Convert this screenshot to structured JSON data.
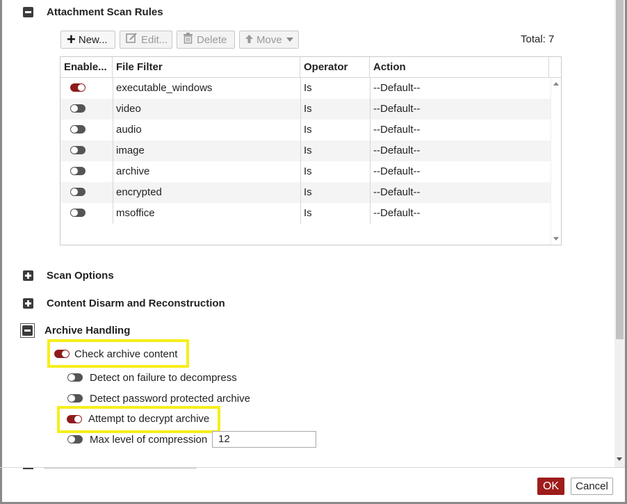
{
  "sections": {
    "attachment_scan_rules": "Attachment Scan Rules",
    "scan_options": "Scan Options",
    "cdr": "Content Disarm and Reconstruction",
    "archive_handling": "Archive Handling"
  },
  "toolbar": {
    "new_label": "New...",
    "edit_label": "Edit...",
    "delete_label": "Delete",
    "move_label": "Move",
    "total_label": "Total: 7"
  },
  "table": {
    "headers": [
      "Enable...",
      "File Filter",
      "Operator",
      "Action"
    ],
    "rows": [
      {
        "enabled": true,
        "filter": "executable_windows",
        "operator": "Is",
        "action": "--Default--"
      },
      {
        "enabled": false,
        "filter": "video",
        "operator": "Is",
        "action": "--Default--"
      },
      {
        "enabled": false,
        "filter": "audio",
        "operator": "Is",
        "action": "--Default--"
      },
      {
        "enabled": false,
        "filter": "image",
        "operator": "Is",
        "action": "--Default--"
      },
      {
        "enabled": false,
        "filter": "archive",
        "operator": "Is",
        "action": "--Default--"
      },
      {
        "enabled": false,
        "filter": "encrypted",
        "operator": "Is",
        "action": "--Default--"
      },
      {
        "enabled": false,
        "filter": "msoffice",
        "operator": "Is",
        "action": "--Default--"
      }
    ]
  },
  "archive": {
    "check_content": {
      "label": "Check archive content",
      "enabled": true
    },
    "detect_failure": {
      "label": "Detect on failure to decompress",
      "enabled": false
    },
    "detect_password": {
      "label": "Detect password protected archive",
      "enabled": false
    },
    "attempt_decrypt": {
      "label": "Attempt to decrypt archive",
      "enabled": true
    },
    "max_level": {
      "label": "Max level of compression",
      "enabled": false,
      "value": "12"
    }
  },
  "footer": {
    "ok_label": "OK",
    "cancel_label": "Cancel"
  },
  "colors": {
    "toggle_on": "#8f1c1c",
    "toggle_off": "#555555",
    "highlight": "#f7ee1c",
    "ok_button": "#9e1c1c"
  }
}
